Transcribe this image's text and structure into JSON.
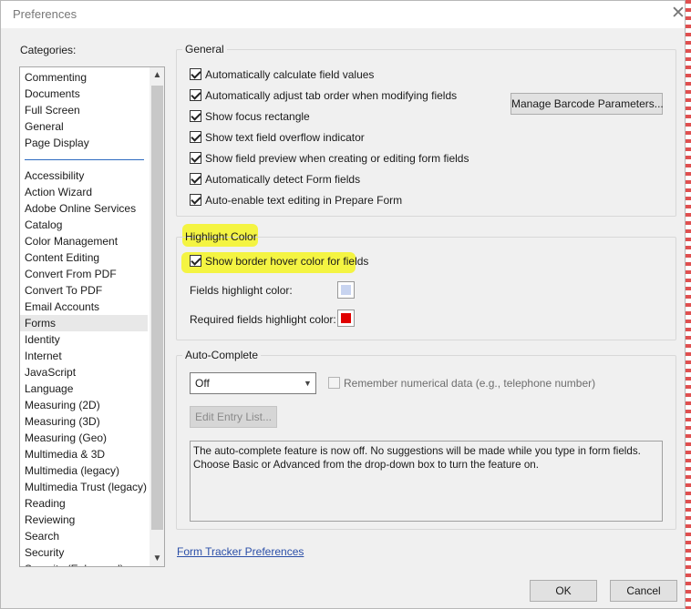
{
  "window": {
    "title": "Preferences",
    "close_glyph": "✕"
  },
  "categories": {
    "label": "Categories:",
    "top_items": [
      "Commenting",
      "Documents",
      "Full Screen",
      "General",
      "Page Display"
    ],
    "items": [
      "Accessibility",
      "Action Wizard",
      "Adobe Online Services",
      "Catalog",
      "Color Management",
      "Content Editing",
      "Convert From PDF",
      "Convert To PDF",
      "Email Accounts",
      "Forms",
      "Identity",
      "Internet",
      "JavaScript",
      "Language",
      "Measuring (2D)",
      "Measuring (3D)",
      "Measuring (Geo)",
      "Multimedia & 3D",
      "Multimedia (legacy)",
      "Multimedia Trust (legacy)",
      "Reading",
      "Reviewing",
      "Search",
      "Security",
      "Security (Enhanced)"
    ],
    "selected": "Forms",
    "scroll_up_glyph": "▲",
    "scroll_down_glyph": "▼"
  },
  "general": {
    "title": "General",
    "checkboxes": [
      {
        "label": "Automatically calculate field values",
        "checked": true
      },
      {
        "label": "Automatically adjust tab order when modifying fields",
        "checked": true
      },
      {
        "label": "Show focus rectangle",
        "checked": true
      },
      {
        "label": "Show text field overflow indicator",
        "checked": true
      },
      {
        "label": "Show field preview when creating or editing form fields",
        "checked": true
      },
      {
        "label": "Automatically detect Form fields",
        "checked": true
      },
      {
        "label": "Auto-enable text editing in Prepare Form",
        "checked": true
      }
    ],
    "manage_barcode_button": "Manage Barcode Parameters..."
  },
  "highlight": {
    "title": "Highlight Color",
    "show_border_hover": {
      "label": "Show border hover color for fields",
      "checked": true
    },
    "fields_label": "Fields highlight color:",
    "fields_color": "#c8d4f0",
    "required_label": "Required fields highlight color:",
    "required_color": "#e00000",
    "marker_color": "#f5f523"
  },
  "autocomplete": {
    "title": "Auto-Complete",
    "mode_selected": "Off",
    "dropdown_glyph": "▼",
    "remember_label": "Remember numerical data (e.g., telephone number)",
    "remember_checked": false,
    "edit_entry_button": "Edit Entry List...",
    "description": "The auto-complete feature is now off. No suggestions will be made while you type in form fields. Choose Basic or Advanced from the drop-down box to turn the feature on."
  },
  "form_tracker_link": "Form Tracker Preferences",
  "footer": {
    "ok": "OK",
    "cancel": "Cancel"
  }
}
